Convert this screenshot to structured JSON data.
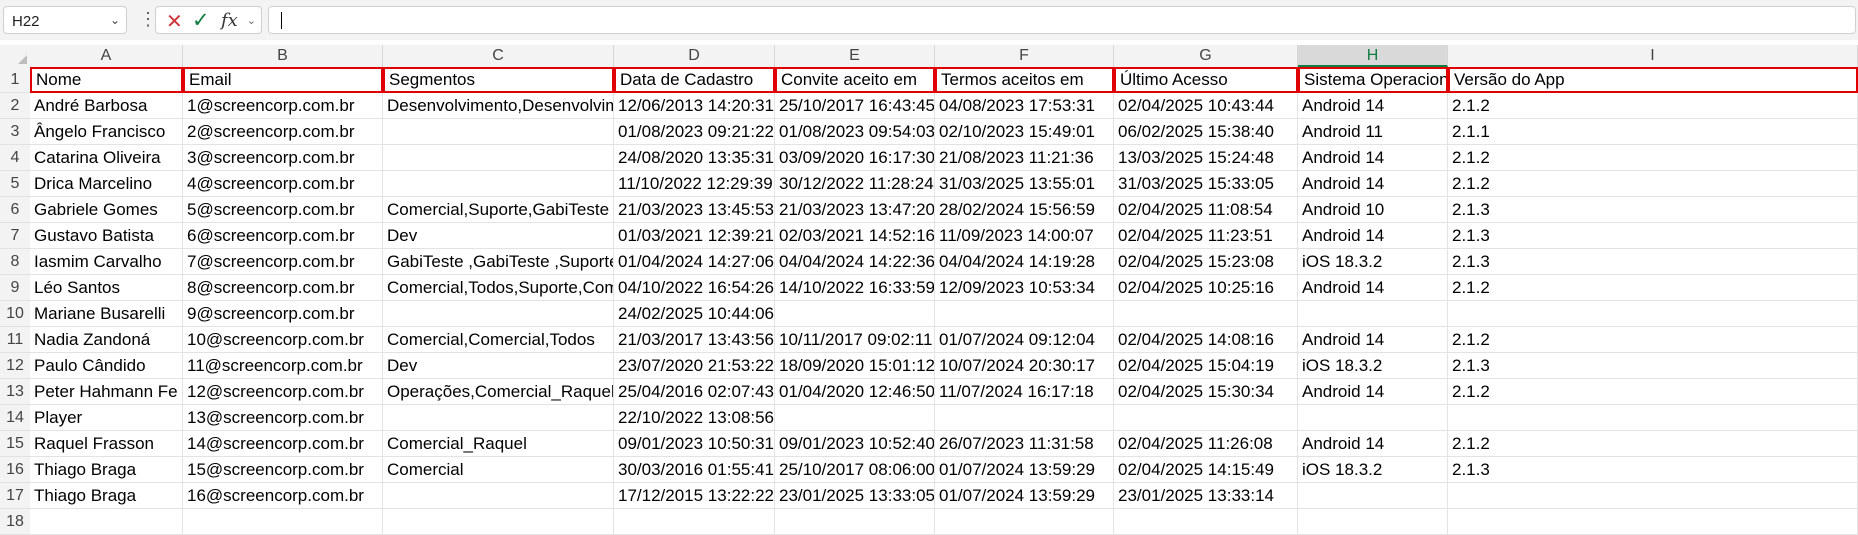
{
  "formula_bar": {
    "name_box": "H22",
    "formula": ""
  },
  "icons": {
    "name_box_dropdown": "chevron-down-icon",
    "options": "vertical-dots-icon",
    "cancel": "cross-icon",
    "enter": "check-icon",
    "function": "fx-icon"
  },
  "accent_colors": {
    "selected_header": "#107c41",
    "highlight_border": "#e00000"
  },
  "columns": [
    "A",
    "B",
    "C",
    "D",
    "E",
    "F",
    "G",
    "H",
    "I"
  ],
  "selected_column": "H",
  "header_row": [
    "Nome",
    "Email",
    "Segmentos",
    "Data de Cadastro",
    "Convite aceito em",
    "Termos aceitos em",
    "Último Acesso",
    "Sistema Operacional",
    "Versão do App"
  ],
  "rows": [
    [
      "André Barbosa",
      "1@screencorp.com.br",
      "Desenvolvimento,Desenvolvimento",
      "12/06/2013 14:20:31",
      "25/10/2017 16:43:45",
      "04/08/2023 17:53:31",
      "02/04/2025 10:43:44",
      "Android 14",
      "2.1.2"
    ],
    [
      "Ângelo Francisco",
      "2@screencorp.com.br",
      "",
      "01/08/2023 09:21:22",
      "01/08/2023 09:54:03",
      "02/10/2023 15:49:01",
      "06/02/2025 15:38:40",
      "Android 11",
      "2.1.1"
    ],
    [
      "Catarina Oliveira",
      "3@screencorp.com.br",
      "",
      "24/08/2020 13:35:31",
      "03/09/2020 16:17:30",
      "21/08/2023 11:21:36",
      "13/03/2025 15:24:48",
      "Android 14",
      "2.1.2"
    ],
    [
      "Drica Marcelino",
      "4@screencorp.com.br",
      "",
      "11/10/2022 12:29:39",
      "30/12/2022 11:28:24",
      "31/03/2025 13:55:01",
      "31/03/2025 15:33:05",
      "Android 14",
      "2.1.2"
    ],
    [
      "Gabriele Gomes",
      "5@screencorp.com.br",
      "Comercial,Suporte,GabiTeste ,Comercial",
      "21/03/2023 13:45:53",
      "21/03/2023 13:47:20",
      "28/02/2024 15:56:59",
      "02/04/2025 11:08:54",
      "Android 10",
      "2.1.3"
    ],
    [
      "Gustavo Batista",
      "6@screencorp.com.br",
      "Dev",
      "01/03/2021 12:39:21",
      "02/03/2021 14:52:16",
      "11/09/2023 14:00:07",
      "02/04/2025 11:23:51",
      "Android 14",
      "2.1.3"
    ],
    [
      "Iasmim Carvalho",
      "7@screencorp.com.br",
      "GabiTeste ,GabiTeste ,Suporte",
      "01/04/2024 14:27:06",
      "04/04/2024 14:22:36",
      "04/04/2024 14:19:28",
      "02/04/2025 15:23:08",
      "iOS 18.3.2",
      "2.1.3"
    ],
    [
      "Léo Santos",
      "8@screencorp.com.br",
      "Comercial,Todos,Suporte,Comercial",
      "04/10/2022 16:54:26",
      "14/10/2022 16:33:59",
      "12/09/2023 10:53:34",
      "02/04/2025 10:25:16",
      "Android 14",
      "2.1.2"
    ],
    [
      "Mariane Busarelli",
      "9@screencorp.com.br",
      "",
      "24/02/2025 10:44:06",
      "",
      "",
      "",
      "",
      ""
    ],
    [
      "Nadia Zandoná",
      "10@screencorp.com.br",
      "Comercial,Comercial,Todos",
      "21/03/2017 13:43:56",
      "10/11/2017 09:02:11",
      "01/07/2024 09:12:04",
      "02/04/2025 14:08:16",
      "Android 14",
      "2.1.2"
    ],
    [
      "Paulo Cândido",
      "11@screencorp.com.br",
      "Dev",
      "23/07/2020 21:53:22",
      "18/09/2020 15:01:12",
      "10/07/2024 20:30:17",
      "02/04/2025 15:04:19",
      "iOS 18.3.2",
      "2.1.3"
    ],
    [
      "Peter Hahmann Fe",
      "12@screencorp.com.br",
      "Operações,Comercial_Raquel,Comercial",
      "25/04/2016 02:07:43",
      "01/04/2020 12:46:50",
      "11/07/2024 16:17:18",
      "02/04/2025 15:30:34",
      "Android 14",
      "2.1.2"
    ],
    [
      "Player",
      "13@screencorp.com.br",
      "",
      "22/10/2022 13:08:56",
      "",
      "",
      "",
      "",
      ""
    ],
    [
      "Raquel Frasson",
      "14@screencorp.com.br",
      "Comercial_Raquel",
      "09/01/2023 10:50:31",
      "09/01/2023 10:52:40",
      "26/07/2023 11:31:58",
      "02/04/2025 11:26:08",
      "Android 14",
      "2.1.2"
    ],
    [
      "Thiago Braga",
      "15@screencorp.com.br",
      "Comercial",
      "30/03/2016 01:55:41",
      "25/10/2017 08:06:00",
      "01/07/2024 13:59:29",
      "02/04/2025 14:15:49",
      "iOS 18.3.2",
      "2.1.3"
    ],
    [
      "Thiago Braga",
      "16@screencorp.com.br",
      "",
      "17/12/2015 13:22:22",
      "23/01/2025 13:33:05",
      "01/07/2024 13:59:29",
      "23/01/2025 13:33:14",
      "",
      ""
    ]
  ],
  "row_numbers": [
    "1",
    "2",
    "3",
    "4",
    "5",
    "6",
    "7",
    "8",
    "9",
    "10",
    "11",
    "12",
    "13",
    "14",
    "15",
    "16",
    "17",
    "18"
  ]
}
